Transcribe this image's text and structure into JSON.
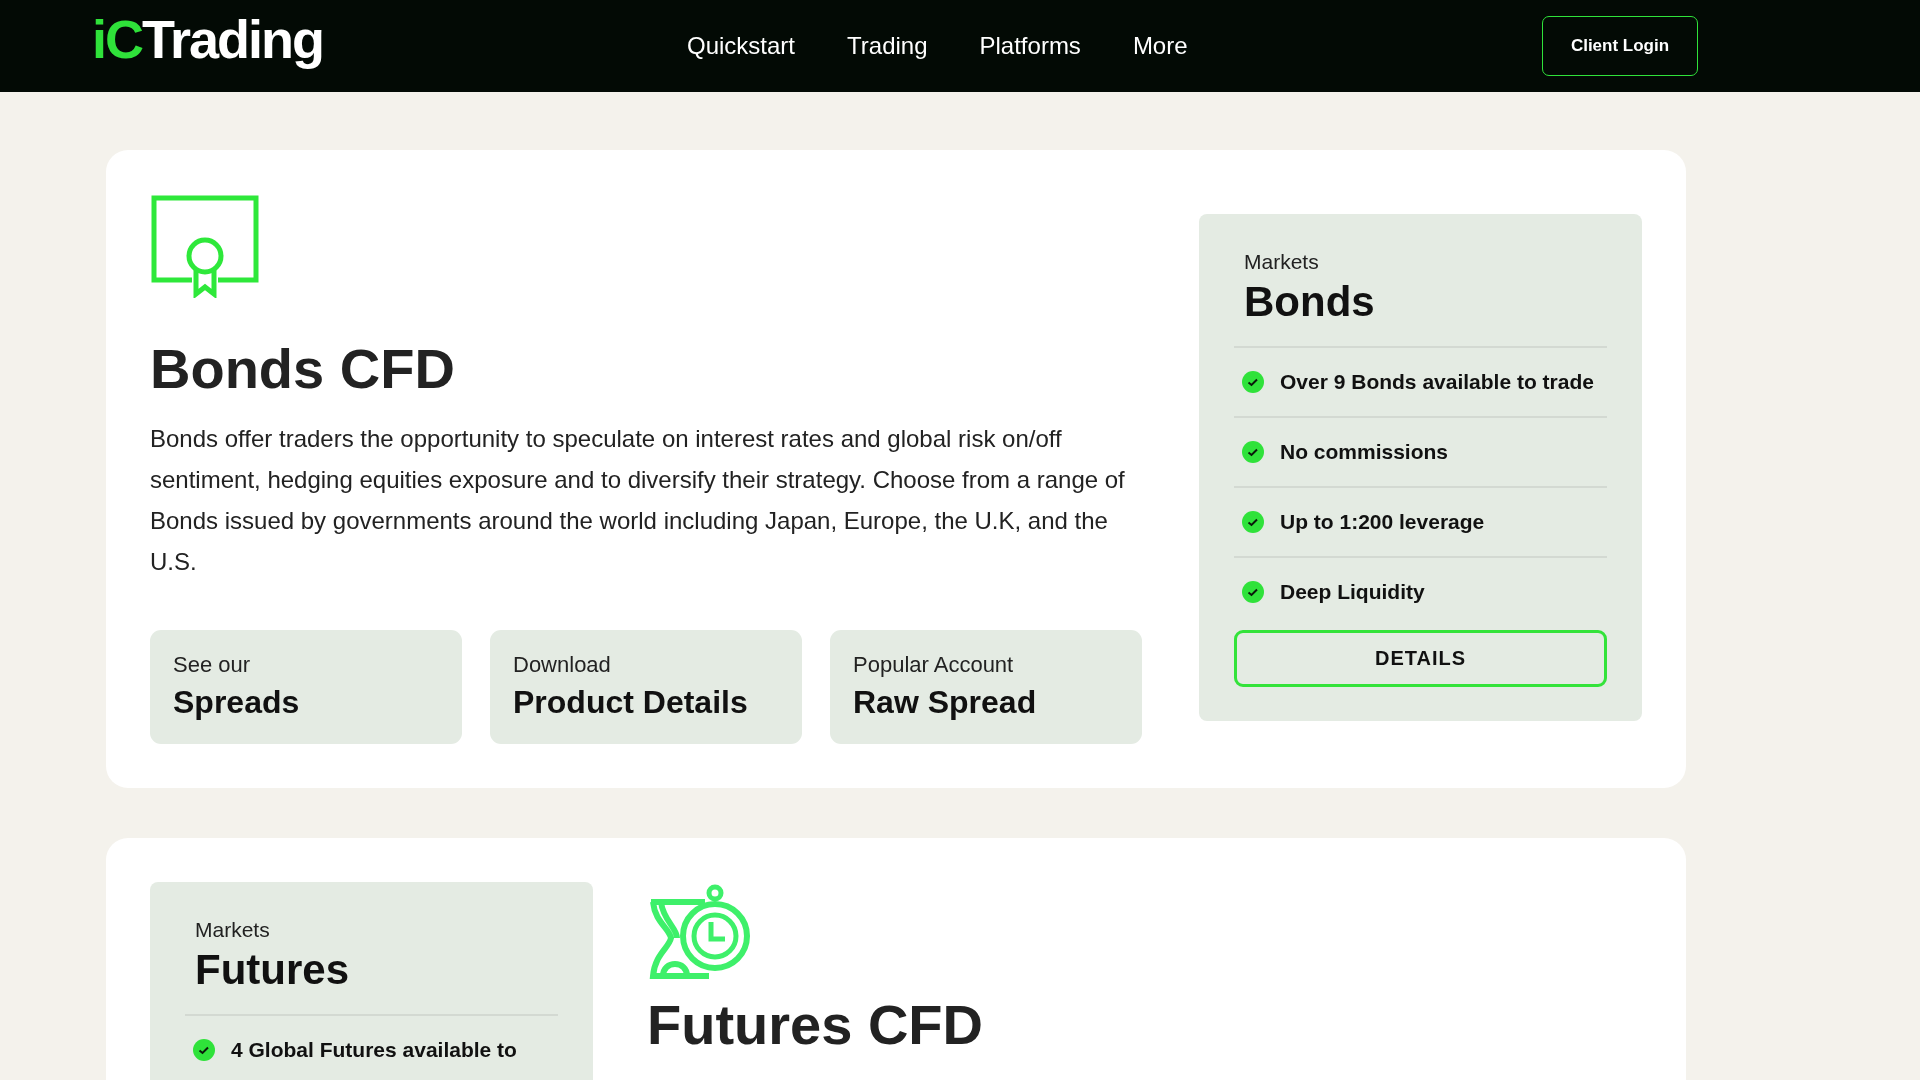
{
  "header": {
    "logo": {
      "accent": "iC",
      "rest": "Trading"
    },
    "nav": [
      {
        "label": "Quickstart"
      },
      {
        "label": "Trading"
      },
      {
        "label": "Platforms"
      },
      {
        "label": "More"
      }
    ],
    "login_button": "Client Login"
  },
  "sections": [
    {
      "title": "Bonds CFD",
      "description": "Bonds offer traders the opportunity to speculate on interest rates and global risk on/off sentiment, hedging equities exposure and to diversify their strategy. Choose from a range of Bonds issued by governments around the world including Japan, Europe, the U.K, and the U.S.",
      "links": [
        {
          "label": "See our",
          "title": "Spreads"
        },
        {
          "label": "Download",
          "title": "Product Details"
        },
        {
          "label": "Popular Account",
          "title": "Raw Spread"
        }
      ],
      "panel": {
        "label": "Markets",
        "title": "Bonds",
        "features": [
          "Over 9 Bonds available to trade",
          "No commissions",
          "Up to 1:200 leverage",
          "Deep Liquidity"
        ],
        "button": "DETAILS"
      }
    },
    {
      "title": "Futures CFD",
      "panel": {
        "label": "Markets",
        "title": "Futures",
        "features": [
          "4 Global Futures available to"
        ]
      }
    }
  ]
}
